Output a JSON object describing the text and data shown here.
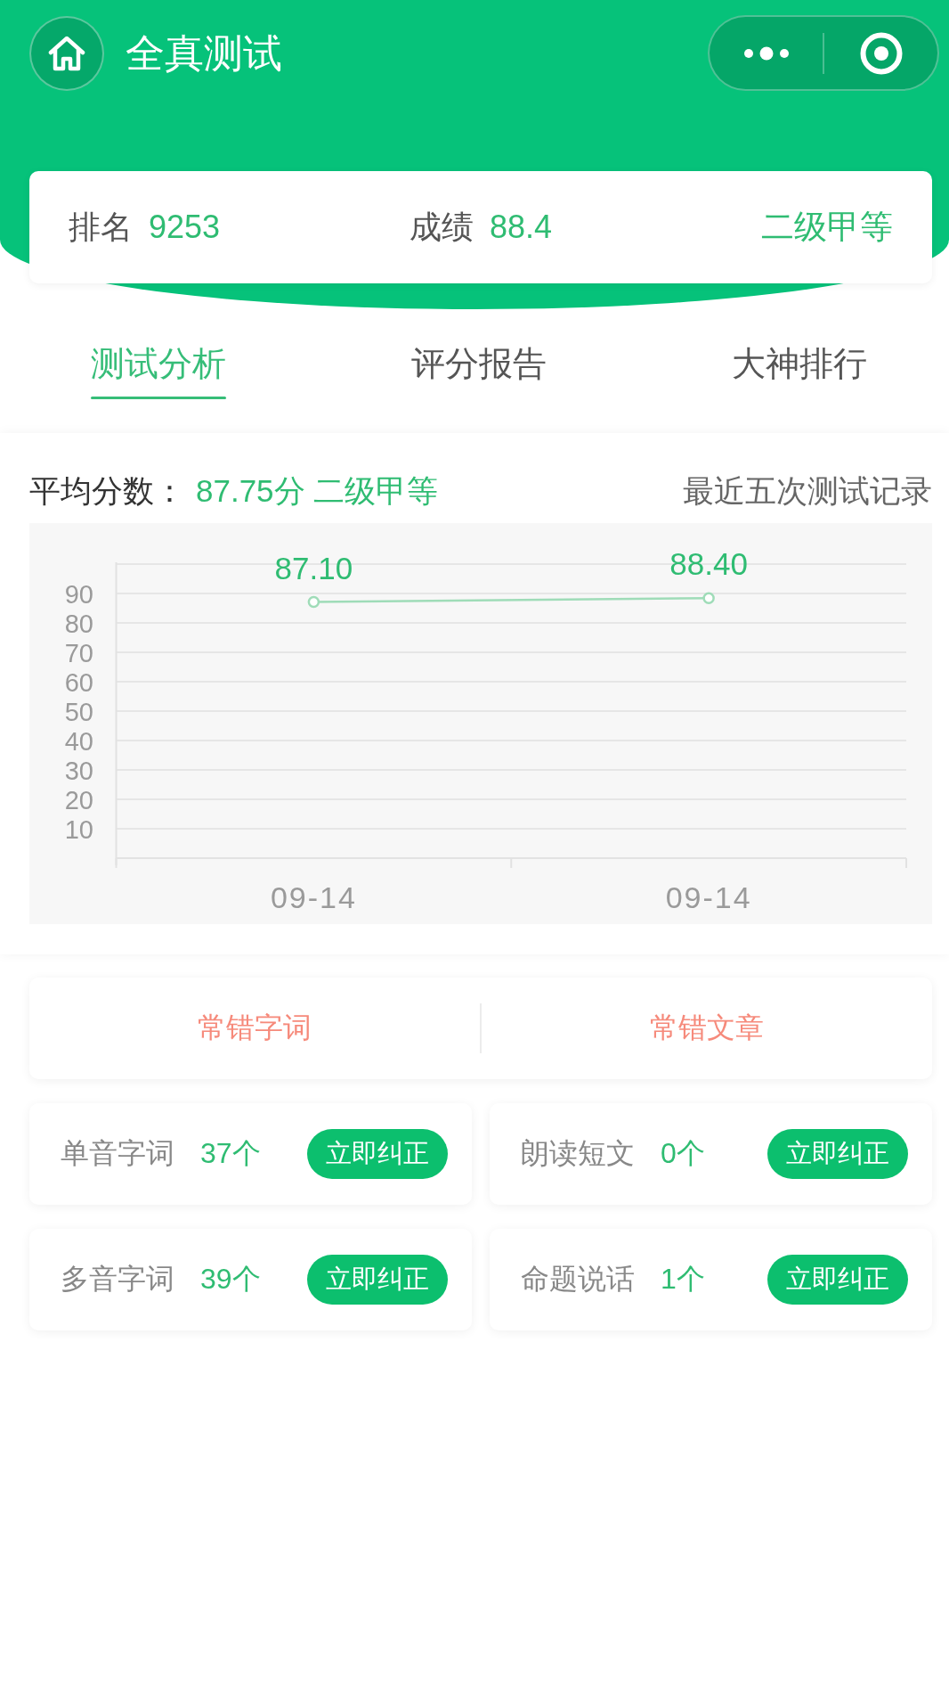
{
  "nav_bar": {
    "title": "全真测试"
  },
  "score_card": {
    "stats": [
      {
        "label": "排名",
        "value": "9253"
      },
      {
        "label": "成绩",
        "value": "88.4"
      }
    ],
    "grade": "二级甲等"
  },
  "tabs": [
    {
      "label": "测试分析",
      "selected": true
    },
    {
      "label": "评分报告",
      "selected": false
    },
    {
      "label": "大神排行",
      "selected": false
    }
  ],
  "analysis": {
    "average_label": "平均分数：",
    "average_value": "87.75分 二级甲等",
    "records_label": "最近五次测试记录",
    "chart_data": {
      "type": "line",
      "categories": [
        "09-14",
        "09-14"
      ],
      "series": [
        {
          "color": "#9fdcb8",
          "marker": "circle",
          "values": [
            87.1,
            88.4
          ]
        }
      ],
      "ylim": [
        0,
        100
      ],
      "yticks": [
        10,
        20,
        30,
        40,
        50,
        60,
        70,
        80,
        90
      ],
      "grid": true,
      "value_labels": [
        "87.10",
        "88.40"
      ]
    }
  },
  "mistake_categories": [
    "常错字词",
    "常错文章"
  ],
  "corrections": [
    {
      "label": "单音字词",
      "count": "37个",
      "action": "立即纠正"
    },
    {
      "label": "朗读短文",
      "count": "0个",
      "action": "立即纠正"
    },
    {
      "label": "多音字词",
      "count": "39个",
      "action": "立即纠正"
    },
    {
      "label": "命题说话",
      "count": "1个",
      "action": "立即纠正"
    }
  ]
}
